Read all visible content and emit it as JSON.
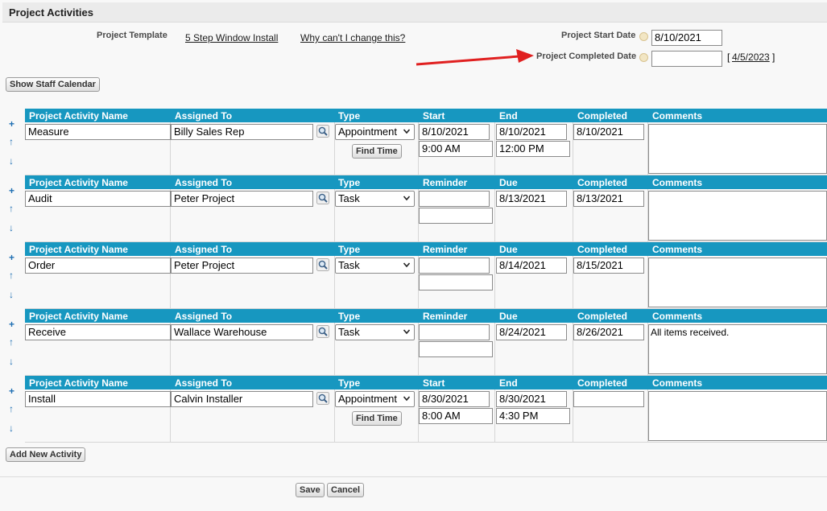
{
  "title": "Project Activities",
  "template": {
    "label": "Project Template",
    "link": "5 Step Window Install",
    "why_link": "Why can't I change this?"
  },
  "dates": {
    "start_label": "Project Start Date",
    "start_value": "8/10/2021",
    "completed_label": "Project Completed Date",
    "completed_value": "",
    "suggested_completed": "4/5/2023",
    "bracket_open": "[",
    "bracket_close": "]"
  },
  "buttons": {
    "staff_calendar": "Show Staff Calendar",
    "add_activity": "Add New Activity",
    "save": "Save",
    "cancel": "Cancel",
    "find_time": "Find Time"
  },
  "row_controls": {
    "add": "+",
    "up": "↑",
    "down": "↓"
  },
  "headers": {
    "name": "Project Activity Name",
    "assigned": "Assigned To",
    "type": "Type",
    "start": "Start",
    "reminder": "Reminder",
    "end": "End",
    "due": "Due",
    "completed": "Completed",
    "comments": "Comments"
  },
  "activities": [
    {
      "name": "Measure",
      "assigned": "Billy Sales Rep",
      "type": "Appointment",
      "date1": "8/10/2021",
      "time1": "9:00 AM",
      "date2": "8/10/2021",
      "time2": "12:00 PM",
      "completed": "8/10/2021",
      "comments": ""
    },
    {
      "name": "Audit",
      "assigned": "Peter Project",
      "type": "Task",
      "date1": "",
      "time1": "",
      "date2": "8/13/2021",
      "time2": "",
      "completed": "8/13/2021",
      "comments": ""
    },
    {
      "name": "Order",
      "assigned": "Peter Project",
      "type": "Task",
      "date1": "",
      "time1": "",
      "date2": "8/14/2021",
      "time2": "",
      "completed": "8/15/2021",
      "comments": ""
    },
    {
      "name": "Receive",
      "assigned": "Wallace Warehouse",
      "type": "Task",
      "date1": "",
      "time1": "",
      "date2": "8/24/2021",
      "time2": "",
      "completed": "8/26/2021",
      "comments": "All items received."
    },
    {
      "name": "Install",
      "assigned": "Calvin Installer",
      "type": "Appointment",
      "date1": "8/30/2021",
      "time1": "8:00 AM",
      "date2": "8/30/2021",
      "time2": "4:30 PM",
      "completed": "",
      "comments": ""
    }
  ],
  "colors": {
    "header_bg": "#1797c0",
    "arrow": "#e02020"
  },
  "icons": {
    "lookup": "magnifier-icon",
    "info": "info-icon",
    "dropdown": "chevron-down-icon"
  }
}
